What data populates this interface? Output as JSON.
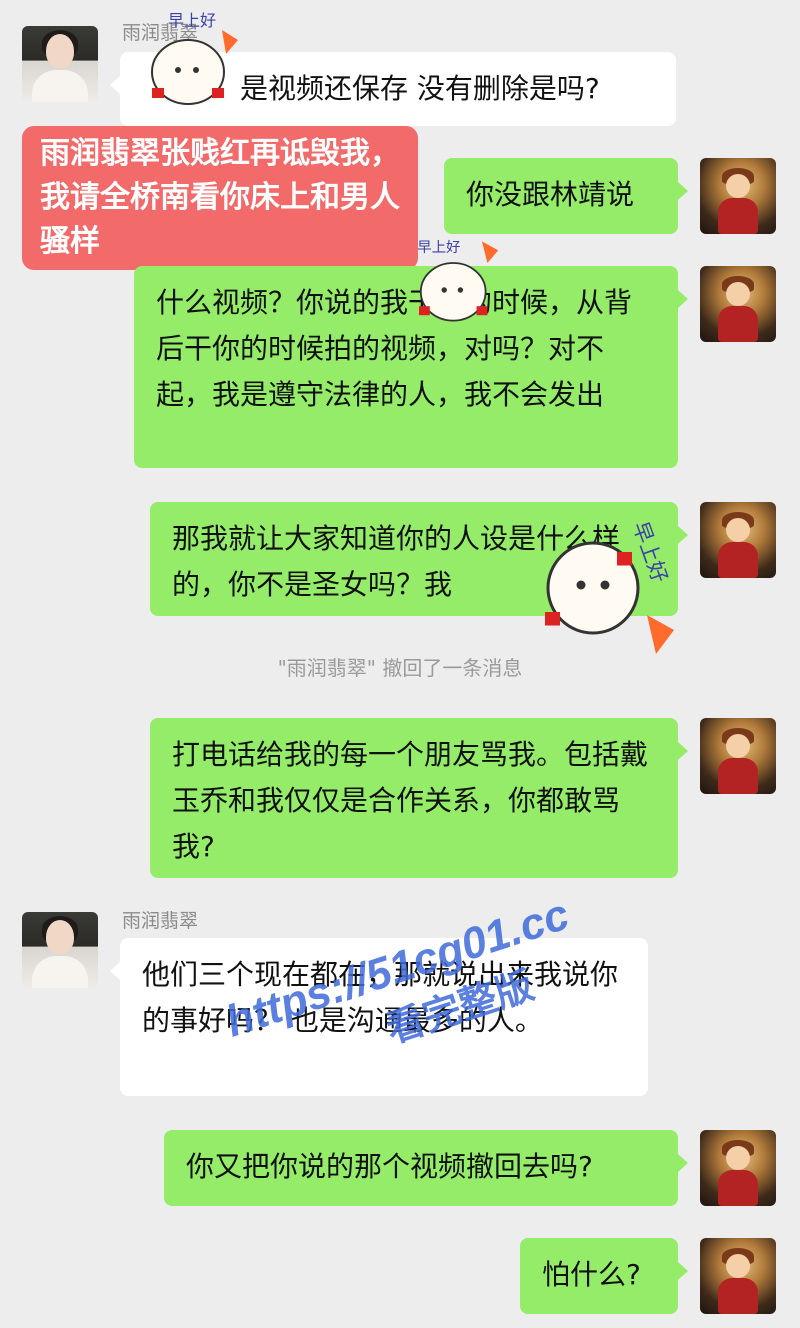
{
  "contacts": {
    "friend_name": "雨润翡翠"
  },
  "messages": [
    {
      "side": "left",
      "text": "是视频还保存 没有删除是吗?"
    },
    {
      "side": "right",
      "text": "你没跟林靖说"
    },
    {
      "side": "right",
      "text": "什么视频？你说的我干你的时候，从背后干你的时候拍的视频，对吗？对不起，我是遵守法律的人，我不会发出"
    },
    {
      "side": "right",
      "text": "那我就让大家知道你的人设是什么样的，你不是圣女吗？我"
    },
    {
      "side": "right",
      "text": "打电话给我的每一个朋友骂我。包括戴玉乔和我仅仅是合作关系，你都敢骂我?"
    },
    {
      "side": "left",
      "text": "他们三个现在都在，那就说出来我说你的事好吗？ 也是沟通最多的人。"
    },
    {
      "side": "right",
      "text": "你又把你说的那个视频撤回去吗?"
    },
    {
      "side": "right",
      "text": "怕什么?"
    }
  ],
  "system_notice": "\"雨润翡翠\" 撤回了一条消息",
  "overlay": {
    "caption": "雨润翡翠张贱红再诋毁我，我请全桥南看你床上和男人骚样"
  },
  "stickers": {
    "label": "早上好"
  },
  "watermark": {
    "url": "https://51cg01.cc",
    "tag": "看完整版"
  }
}
